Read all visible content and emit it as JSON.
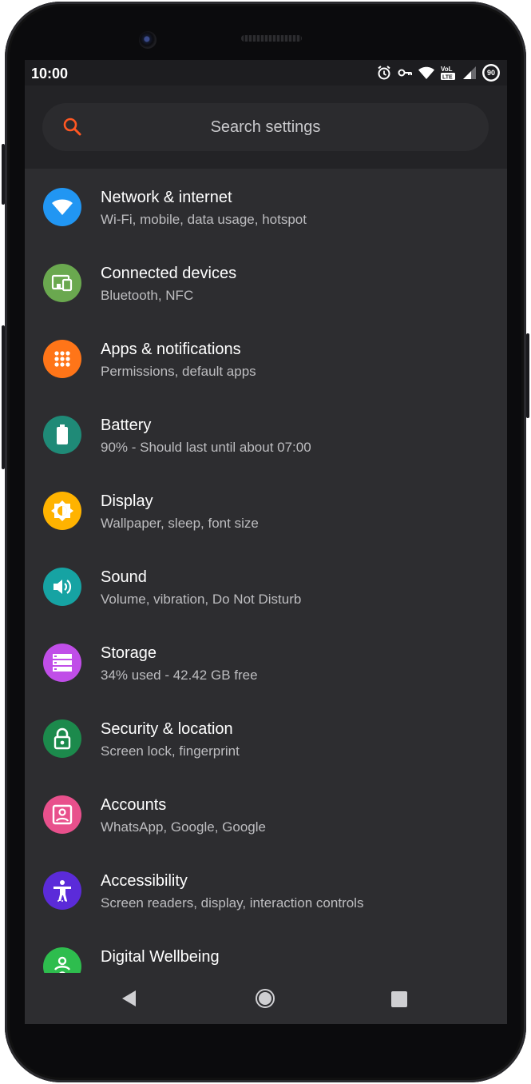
{
  "status_bar": {
    "time": "10:00",
    "battery_level": "90",
    "icons": [
      "alarm-icon",
      "vpn-key-icon",
      "wifi-icon",
      "volte-lte-icon",
      "signal-icon",
      "battery-icon"
    ]
  },
  "search": {
    "placeholder": "Search settings"
  },
  "settings": [
    {
      "title": "Network & internet",
      "subtitle": "Wi-Fi, mobile, data usage, hotspot",
      "icon": "wifi-icon",
      "color": "#2196f3"
    },
    {
      "title": "Connected devices",
      "subtitle": "Bluetooth, NFC",
      "icon": "devices-icon",
      "color": "#6aa84f"
    },
    {
      "title": "Apps & notifications",
      "subtitle": "Permissions, default apps",
      "icon": "apps-grid-icon",
      "color": "#ff7518"
    },
    {
      "title": "Battery",
      "subtitle": "90% - Should last until about 07:00",
      "icon": "battery-icon",
      "color": "#1f8a77"
    },
    {
      "title": "Display",
      "subtitle": "Wallpaper, sleep, font size",
      "icon": "brightness-icon",
      "color": "#ffb300"
    },
    {
      "title": "Sound",
      "subtitle": "Volume, vibration, Do Not Disturb",
      "icon": "volume-icon",
      "color": "#16a3a3"
    },
    {
      "title": "Storage",
      "subtitle": "34% used - 42.42 GB free",
      "icon": "storage-icon",
      "color": "#c04ee8"
    },
    {
      "title": "Security & location",
      "subtitle": "Screen lock, fingerprint",
      "icon": "lock-icon",
      "color": "#1c8a4c"
    },
    {
      "title": "Accounts",
      "subtitle": "WhatsApp, Google, Google",
      "icon": "account-icon",
      "color": "#e8508c"
    },
    {
      "title": "Accessibility",
      "subtitle": "Screen readers, display, interaction controls",
      "icon": "accessibility-icon",
      "color": "#5b2bd9"
    },
    {
      "title": "Digital Wellbeing",
      "subtitle": "",
      "icon": "wellbeing-icon",
      "color": "#2ebd4e"
    }
  ],
  "nav_bar": {
    "buttons": [
      "back-icon",
      "home-icon",
      "recents-icon"
    ]
  },
  "colors": {
    "accent": "#ff5722",
    "background": "#2d2d30",
    "header": "#232326"
  }
}
